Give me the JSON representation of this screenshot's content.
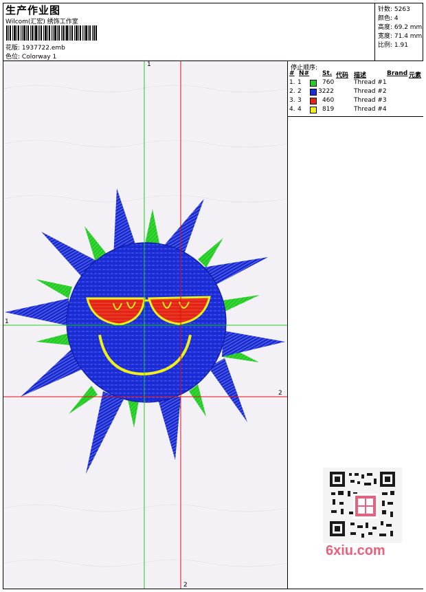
{
  "header": {
    "title": "生产作业图",
    "company": "Wilcom(汇宏) 绣饰工作室",
    "design_label": "花版:",
    "design_value": "1937722.emb",
    "colorway_label": "色位:",
    "colorway_value": "Colorway 1"
  },
  "stats": {
    "stitches": "针数: 5263",
    "colors": "颜色: 4",
    "height": "高度: 69.2 mm",
    "width": "宽度: 71.4 mm",
    "ratio": "比例: 1.91"
  },
  "threads": {
    "title": "停止顺序:",
    "headers": {
      "num": "#",
      "n": "N#",
      "st": "St.",
      "code": "代码",
      "desc": "描述",
      "brand": "Brand",
      "element": "元素"
    },
    "rows": [
      {
        "num": "1.",
        "n": "1",
        "st": "760",
        "desc": "Thread #1",
        "color": "#22cc22"
      },
      {
        "num": "2.",
        "n": "2",
        "st": "3222",
        "desc": "Thread #2",
        "color": "#1a2cd6"
      },
      {
        "num": "3.",
        "n": "3",
        "st": "460",
        "desc": "Thread #3",
        "color": "#e32414"
      },
      {
        "num": "4.",
        "n": "4",
        "st": "819",
        "desc": "Thread #4",
        "color": "#f0ef1a"
      }
    ]
  },
  "canvas": {
    "axis_labels": {
      "green_top": "1",
      "green_left": "1",
      "red_right": "2",
      "red_bottom": "2"
    },
    "colors": {
      "green": "#22cc22",
      "blue": "#1a2cd6",
      "red": "#e32414",
      "yellow": "#f0ef1a",
      "axis_green": "#1bd01b",
      "axis_red": "#e01010"
    }
  },
  "watermark": {
    "text": "6xiu.com",
    "color": "#e9607c"
  }
}
